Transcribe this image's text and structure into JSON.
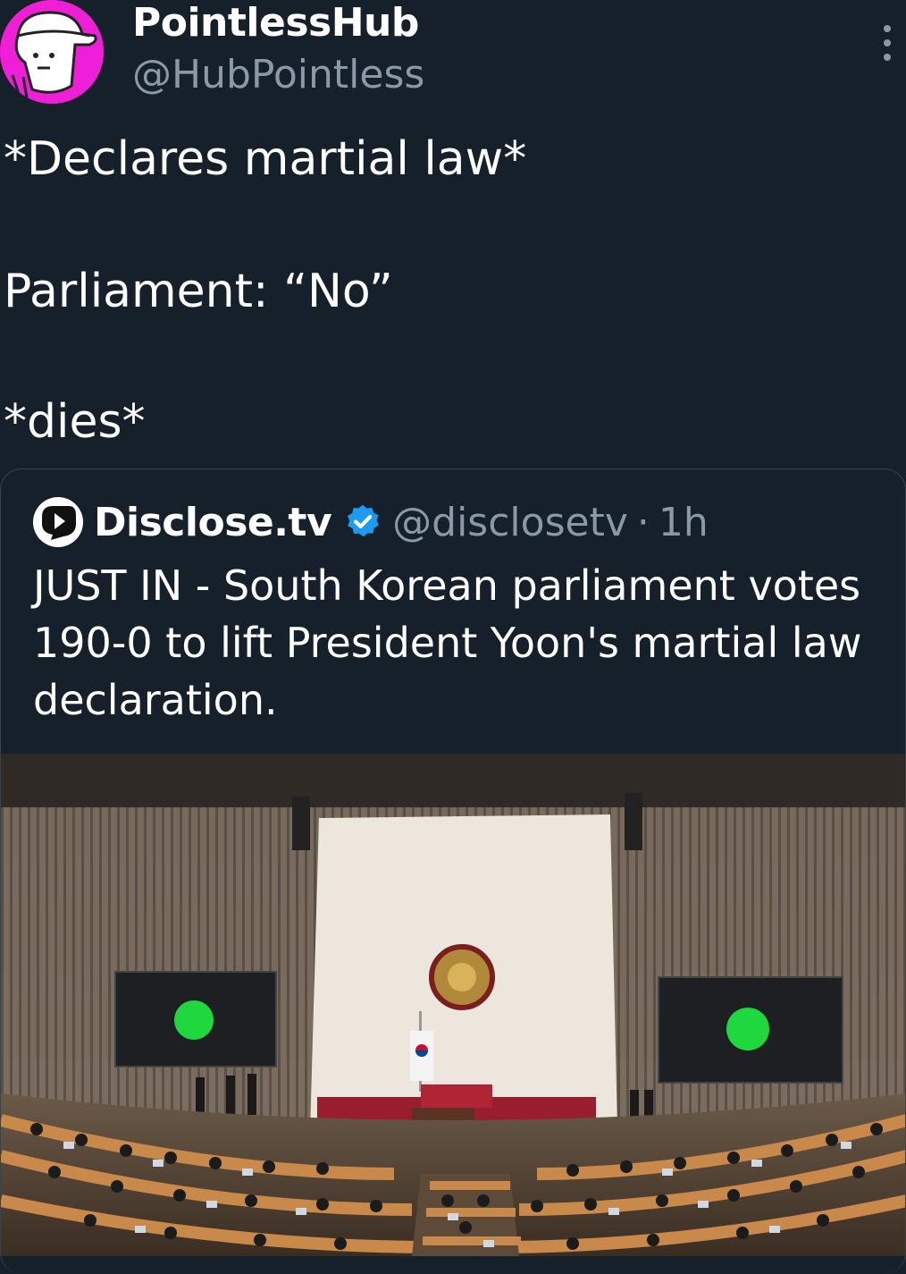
{
  "author": {
    "display_name": "PointlessHub",
    "handle": "@HubPointless",
    "avatar_icon": "cartoon-cap-character-icon",
    "avatar_color": "#ee1fd6"
  },
  "tweet": {
    "line1": "*Declares martial law*",
    "line2": "Parliament: “No”",
    "line3": "*dies*"
  },
  "quoted": {
    "name": "Disclose.tv",
    "handle": "@disclosetv",
    "separator": "·",
    "time": "1h",
    "verified_icon": "verified-badge-icon",
    "verified_color": "#1d9bf0",
    "text": "JUST IN - South Korean parliament votes 190-0 to lift President Yoon's martial law declaration.",
    "image_icon": "parliament-chamber-photo"
  },
  "theme": {
    "background": "#15202b",
    "secondary_text": "#8b98a5",
    "border": "#38444d"
  }
}
